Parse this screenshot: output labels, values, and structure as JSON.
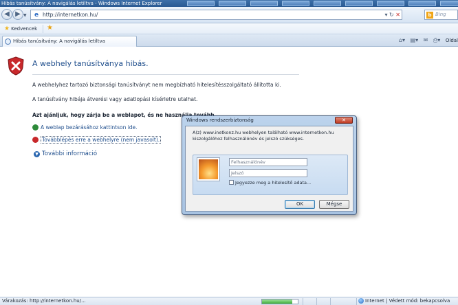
{
  "window": {
    "title": "Hibás tanúsítvány: A navigálás letiltva - Windows Internet Explorer"
  },
  "address_bar": {
    "url": "http://internetkon.hu/"
  },
  "search": {
    "engine": "Bing"
  },
  "favorites_bar": {
    "favorites_label": "Kedvencek"
  },
  "tab": {
    "label": "Hibás tanúsítvány: A navigálás letiltva"
  },
  "command_bar": {
    "page_label": "Oldal"
  },
  "cert_error": {
    "heading": "A webhely tanúsítványa hibás.",
    "paragraph1": "A webhelyhez tartozó biztonsági tanúsítványt nem megbízható hitelesítésszolgáltató állította ki.",
    "paragraph2": "A tanúsítvány hibája átverési vagy adatlopási kísérletre utalhat.",
    "recommendation": "Azt ajánljuk, hogy zárja be a weblapot, és ne használja tovább.",
    "close_link": "A weblap bezárásához kattintson ide.",
    "continue_link": "Továbblépés erre a webhelyre (nem javasolt).",
    "more_info": "További információ"
  },
  "dialog": {
    "title": "Windows rendszerbiztonság",
    "message": "A(z) www.inetkonz.hu webhelyen található www.internetkon.hu kiszolgálóhoz felhasználónév és jelszó szükséges.",
    "username_placeholder": "Felhasználónév",
    "password_placeholder": "Jelszó",
    "remember_label": "Jegyezze meg a hitelesítő adata...",
    "ok_label": "OK",
    "cancel_label": "Mégse"
  },
  "status_bar": {
    "status_text": "Várakozás: http://internetkon.hu/...",
    "progress": 0.85,
    "zone_text": "Internet | Védett mód: bekapcsolva"
  },
  "colors": {
    "heading_blue": "#1f4e8c",
    "error_red": "#c8282b",
    "safe_green": "#2e8b3a",
    "dialog_frame": "#bcd3ec"
  }
}
